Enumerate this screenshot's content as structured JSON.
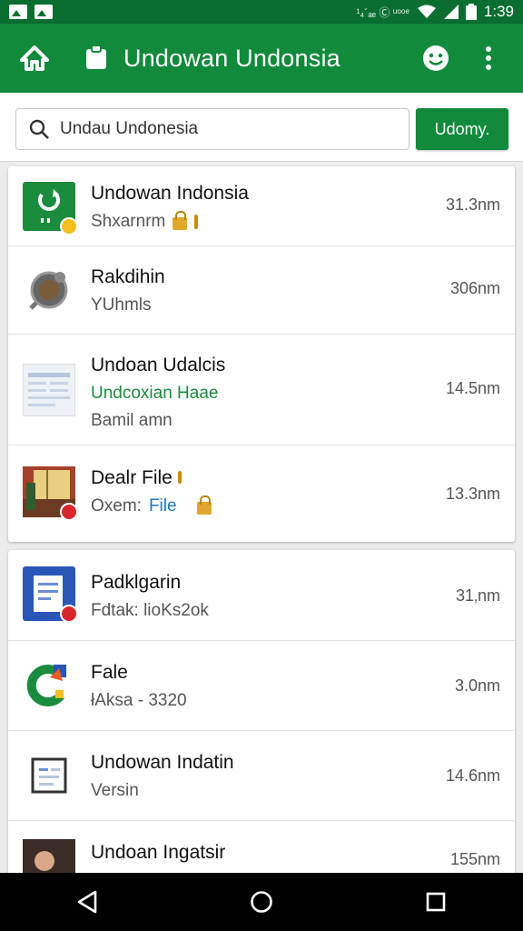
{
  "status_bar": {
    "icons": [
      "gallery-icon",
      "image-icon"
    ],
    "indicators": "¹₄´ₐₑ Ⓒ ᵘᵒᵒᵉ",
    "time": "1:39"
  },
  "toolbar": {
    "title": "Undowan Undonsia",
    "icons": [
      "home-icon",
      "clipboard-icon",
      "smiley-icon",
      "overflow-menu-icon"
    ]
  },
  "search": {
    "value": "Undau Undonesia",
    "button_label": "Udomy."
  },
  "list_top": [
    {
      "title": "Undowan Indonsia",
      "subtitle": "Shxarnrm",
      "size": "31.3nm",
      "icon": "app-green-icon"
    },
    {
      "title": "Rakdihin",
      "subtitle": "YUhmls",
      "size": "306nm",
      "icon": "gear-lens-icon"
    },
    {
      "title": "Undoan Udalcis",
      "subtitle": "Undcoxian Haae",
      "line3": "Bamil amn",
      "size": "14.5nm",
      "icon": "document-preview-icon"
    },
    {
      "title": "Dealr File",
      "subtitle_a": "Oxem:",
      "subtitle_b": "File",
      "size": "13.3nm",
      "icon": "photo-thumb-icon"
    }
  ],
  "list_bottom": [
    {
      "title": "Padklgarin",
      "subtitle": "Fdtak: lioKs2ok",
      "size": "31‚nm",
      "icon": "blue-doc-icon"
    },
    {
      "title": "Fale",
      "subtitle": "łAksa - 3320",
      "size": "3.0nm",
      "icon": "google-c-icon"
    },
    {
      "title": "Undowan Indatin",
      "subtitle": "Versin",
      "size": "14.6nm",
      "icon": "framed-doc-icon"
    },
    {
      "title": "Undoan Ingatsir",
      "size": "155nm",
      "icon": "person-photo-icon"
    }
  ],
  "navbar": {
    "buttons": [
      "back-icon",
      "home-circle-icon",
      "recents-icon"
    ]
  },
  "colors": {
    "primary": "#118a3c",
    "primary_dark": "#0b6e31",
    "accent_green": "#1a8c3e",
    "accent_blue": "#1a79c8"
  }
}
